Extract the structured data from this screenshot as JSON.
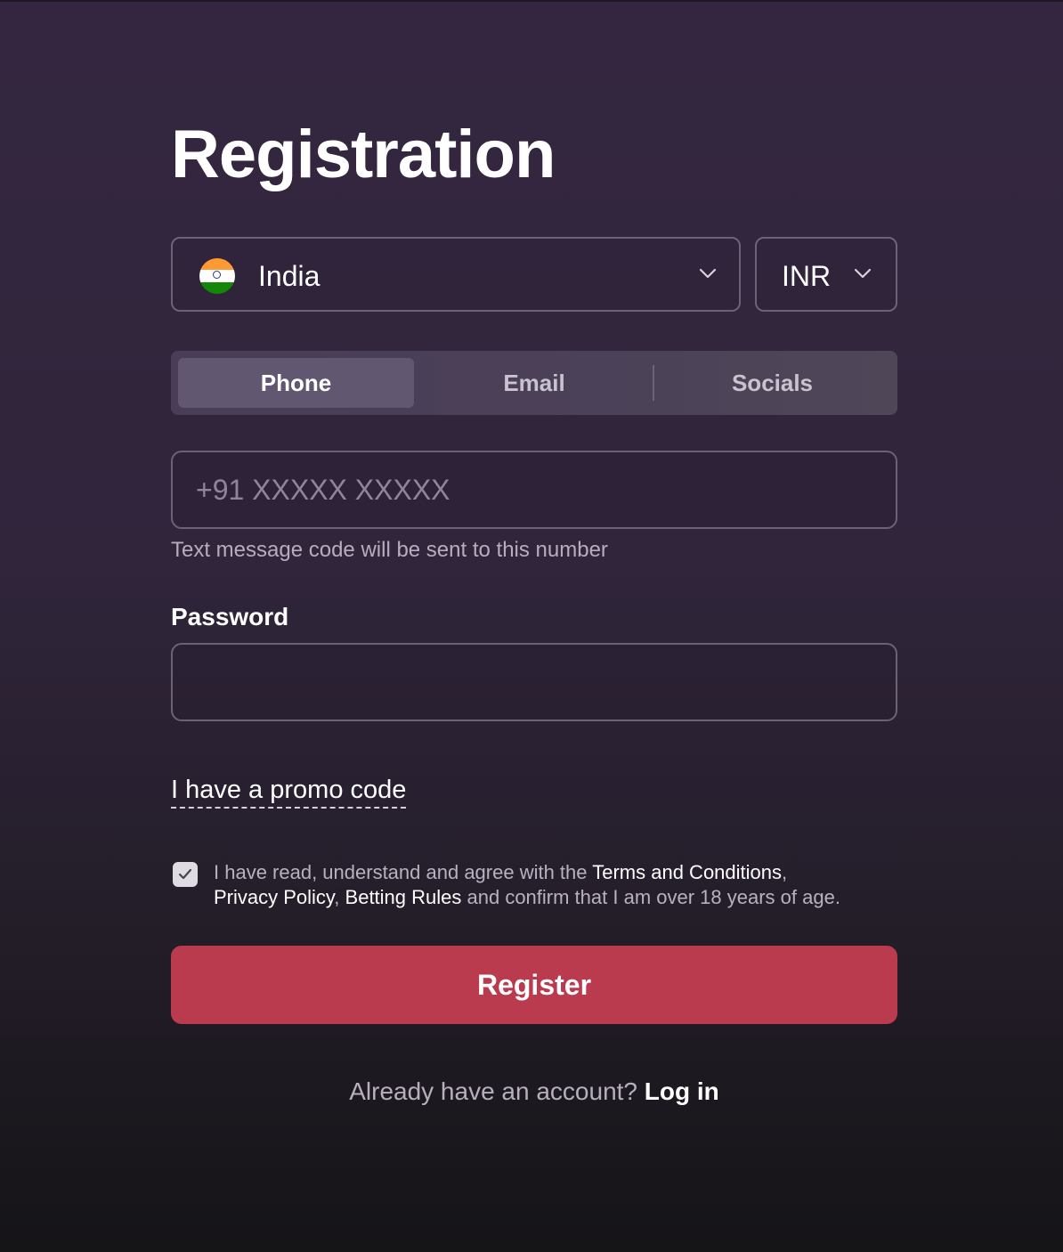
{
  "page": {
    "title": "Registration"
  },
  "country_select": {
    "value": "India",
    "flag_icon": "india-flag-icon",
    "chevron_icon": "chevron-down-icon"
  },
  "currency_select": {
    "value": "INR",
    "chevron_icon": "chevron-down-icon"
  },
  "tabs": [
    {
      "label": "Phone",
      "active": true
    },
    {
      "label": "Email",
      "active": false
    },
    {
      "label": "Socials",
      "active": false
    }
  ],
  "phone": {
    "placeholder": "+91 XXXXX XXXXX",
    "hint": "Text message code will be sent to this number"
  },
  "password": {
    "label": "Password",
    "value": ""
  },
  "promo": {
    "link_text": "I have a promo code"
  },
  "agreement": {
    "checked": true,
    "text_1": "I have read, understand and agree with the ",
    "terms_link": "Terms and Conditions",
    "sep_1": ",",
    "privacy_link": "Privacy Policy",
    "sep_2": ", ",
    "betting_link": "Betting Rules",
    "text_2": " and confirm that I am over 18 years of age."
  },
  "register_button": {
    "label": "Register"
  },
  "login": {
    "prompt": "Already have an account?",
    "link_text": "Log in"
  },
  "colors": {
    "accent": "#b93b4d",
    "background_top": "#342640",
    "background_bottom": "#151417"
  }
}
